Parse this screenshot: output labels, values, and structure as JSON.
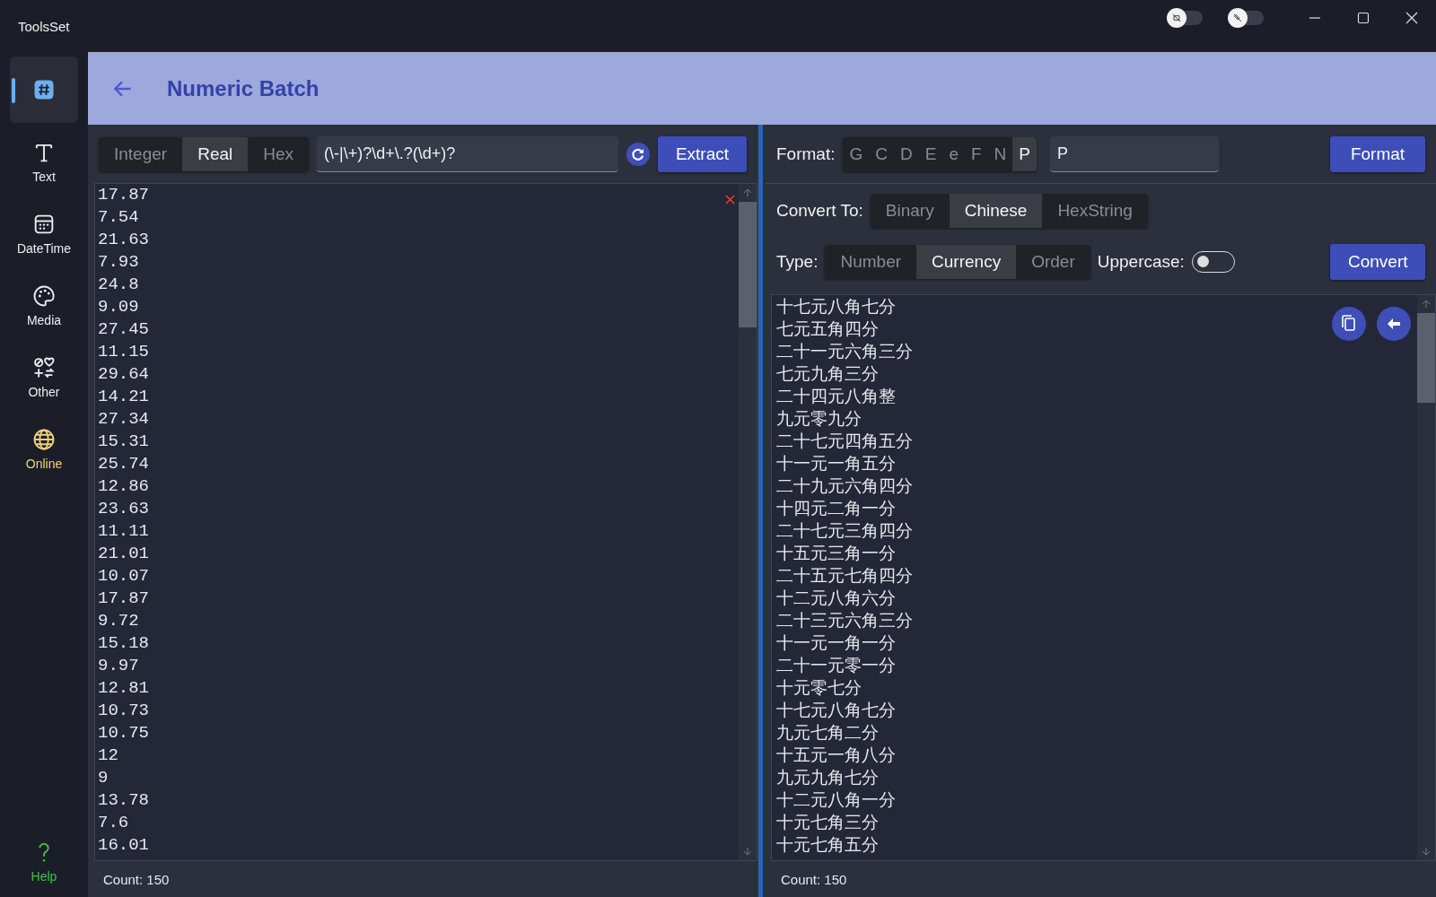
{
  "window": {
    "title": "ToolsSet"
  },
  "title_toggles": [
    {
      "on": false
    },
    {
      "on": false
    }
  ],
  "sidebar": {
    "items": [
      {
        "selected": true
      },
      {
        "label": "Text",
        "selected": false
      },
      {
        "label": "DateTime",
        "selected": false
      },
      {
        "label": "Media",
        "selected": false
      },
      {
        "label": "Other",
        "selected": false
      },
      {
        "label": "Online",
        "selected": false,
        "color": "#f0d37a"
      }
    ],
    "help": {
      "label": "Help",
      "color": "#3cc43c"
    }
  },
  "header": {
    "title": "Numeric Batch"
  },
  "extract": {
    "modes": [
      {
        "label": "Integer",
        "selected": false
      },
      {
        "label": "Real",
        "selected": true
      },
      {
        "label": "Hex",
        "selected": false
      }
    ],
    "pattern": "(\\-|\\+)?\\d+\\.?(\\d+)?",
    "button": "Extract"
  },
  "input_list": {
    "lines": [
      "17.87",
      "7.54",
      "21.63",
      "7.93",
      "24.8",
      "9.09",
      "27.45",
      "11.15",
      "29.64",
      "14.21",
      "27.34",
      "15.31",
      "25.74",
      "12.86",
      "23.63",
      "11.11",
      "21.01",
      "10.07",
      "17.87",
      "9.72",
      "15.18",
      "9.97",
      "12.81",
      "10.73",
      "10.75",
      "12",
      "9",
      "13.78",
      "7.6",
      "16.01"
    ],
    "count": "Count: 150"
  },
  "format": {
    "label": "Format:",
    "specifiers": [
      {
        "label": "G",
        "selected": false
      },
      {
        "label": "C",
        "selected": false
      },
      {
        "label": "D",
        "selected": false
      },
      {
        "label": "E",
        "selected": false
      },
      {
        "label": "e",
        "selected": false
      },
      {
        "label": "F",
        "selected": false
      },
      {
        "label": "N",
        "selected": false
      },
      {
        "label": "P",
        "selected": true
      }
    ],
    "value": "P",
    "button": "Format"
  },
  "convert": {
    "label": "Convert To:",
    "targets": [
      {
        "label": "Binary",
        "selected": false
      },
      {
        "label": "Chinese",
        "selected": true
      },
      {
        "label": "HexString",
        "selected": false
      }
    ],
    "type_label": "Type:",
    "types": [
      {
        "label": "Number",
        "selected": false
      },
      {
        "label": "Currency",
        "selected": true
      },
      {
        "label": "Order",
        "selected": false
      }
    ],
    "uppercase_label": "Uppercase:",
    "uppercase": false,
    "button": "Convert"
  },
  "output_list": {
    "lines": [
      "十七元八角七分",
      "七元五角四分",
      "二十一元六角三分",
      "七元九角三分",
      "二十四元八角整",
      "九元零九分",
      "二十七元四角五分",
      "十一元一角五分",
      "二十九元六角四分",
      "十四元二角一分",
      "二十七元三角四分",
      "十五元三角一分",
      "二十五元七角四分",
      "十二元八角六分",
      "二十三元六角三分",
      "十一元一角一分",
      "二十一元零一分",
      "十元零七分",
      "十七元八角七分",
      "九元七角二分",
      "十五元一角八分",
      "九元九角七分",
      "十二元八角一分",
      "十元七角三分",
      "十元七角五分"
    ],
    "count": "Count: 150"
  }
}
